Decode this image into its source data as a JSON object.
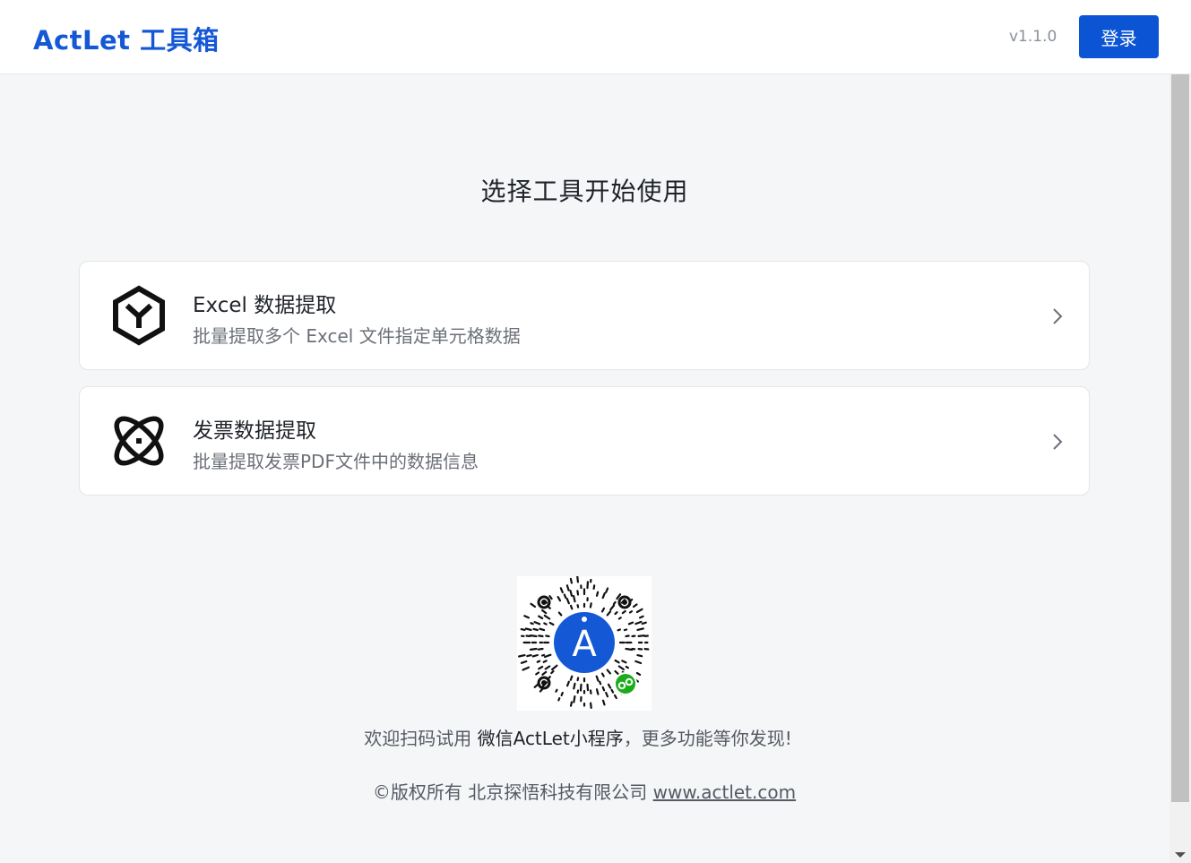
{
  "header": {
    "logo": "ActLet 工具箱",
    "version": "v1.1.0",
    "login_label": "登录"
  },
  "main": {
    "title": "选择工具开始使用",
    "tools": [
      {
        "title": "Excel 数据提取",
        "description": "批量提取多个 Excel 文件指定单元格数据",
        "icon": "hexagon-y-icon"
      },
      {
        "title": "发票数据提取",
        "description": "批量提取发票PDF文件中的数据信息",
        "icon": "atom-icon"
      }
    ]
  },
  "footer": {
    "qr_icon": "miniprogram-qr-code",
    "qr_letter": "A",
    "promo_prefix": "欢迎扫码试用 ",
    "promo_highlight": "微信ActLet小程序",
    "promo_suffix": "，更多功能等你发现!",
    "copyright_text": "©版权所有 北京探悟科技有限公司 ",
    "website": "www.actlet.com"
  },
  "colors": {
    "brand": "#1558d6",
    "button": "#0b55d5",
    "background": "#f5f6f8",
    "wechat_green": "#1aad19"
  }
}
